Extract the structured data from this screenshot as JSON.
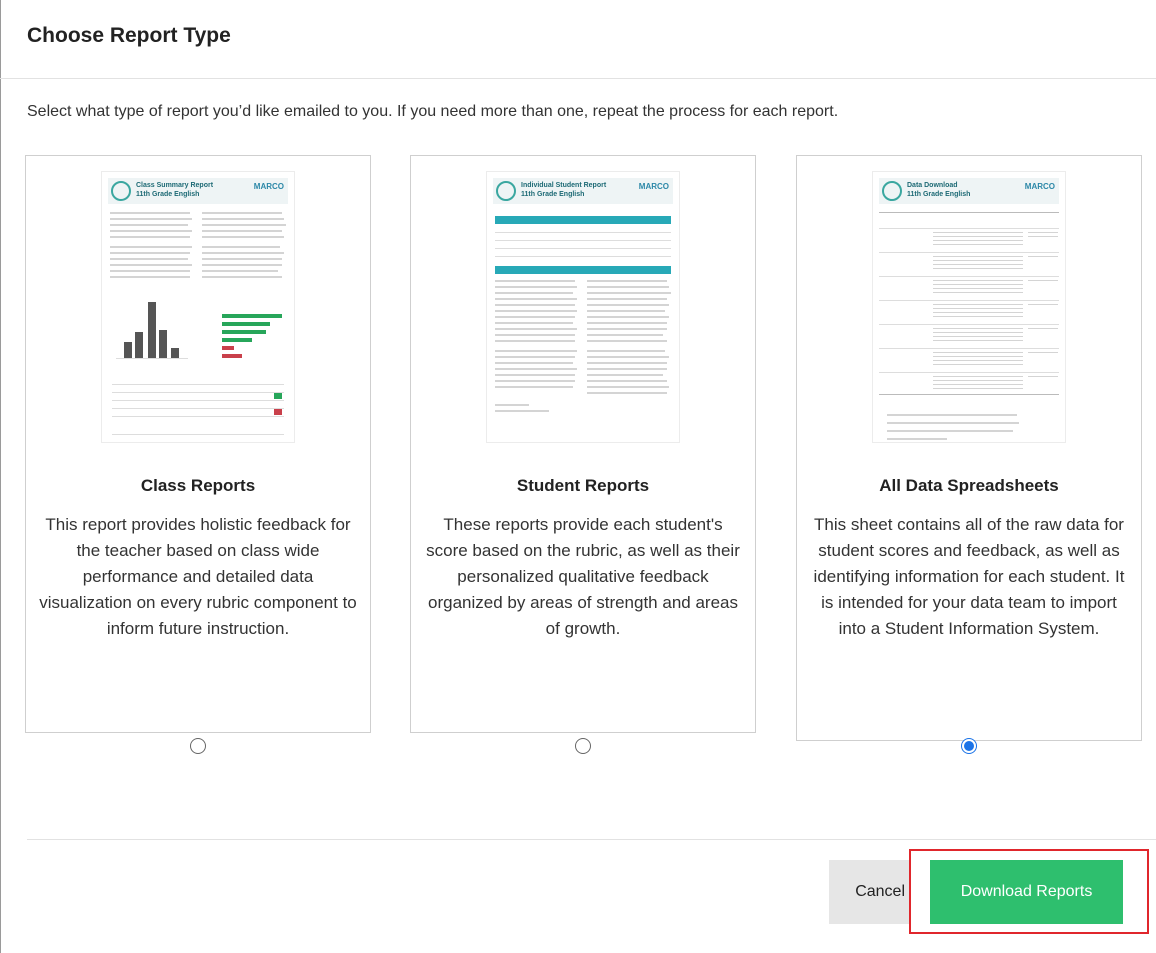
{
  "dialog": {
    "title": "Choose Report Type",
    "instructions": "Select what type of report you’d like emailed to you. If you need more than one, repeat the process for each report."
  },
  "options": [
    {
      "name": "Class Reports",
      "description": "This report provides holistic feedback for the teacher based on class wide performance and detailed data visualization on every rubric component to inform future instruction.",
      "selected": false,
      "thumbnail": {
        "title": "Class Summary Report",
        "subtitle": "11th Grade English",
        "brand": "MARCO"
      }
    },
    {
      "name": "Student Reports",
      "description": "These reports provide each student's score based on the rubric, as well as their personalized qualitative feedback organized by areas of strength and areas of growth.",
      "selected": false,
      "thumbnail": {
        "title": "Individual Student Report",
        "subtitle": "11th Grade English",
        "brand": "MARCO"
      }
    },
    {
      "name": "All Data Spreadsheets",
      "description": "This sheet contains all of the raw data for student scores and feedback, as well as identifying information for each student. It is intended for your data team to import into a Student Information System.",
      "selected": true,
      "thumbnail": {
        "title": "Data Download",
        "subtitle": "11th Grade English",
        "brand": "MARCO"
      }
    }
  ],
  "footer": {
    "cancel_label": "Cancel",
    "download_label": "Download Reports"
  },
  "colors": {
    "accent_green": "#2ebf6e",
    "radio_blue": "#1a73e8",
    "highlight_red": "#e0262c",
    "teal": "#27a9b7"
  }
}
